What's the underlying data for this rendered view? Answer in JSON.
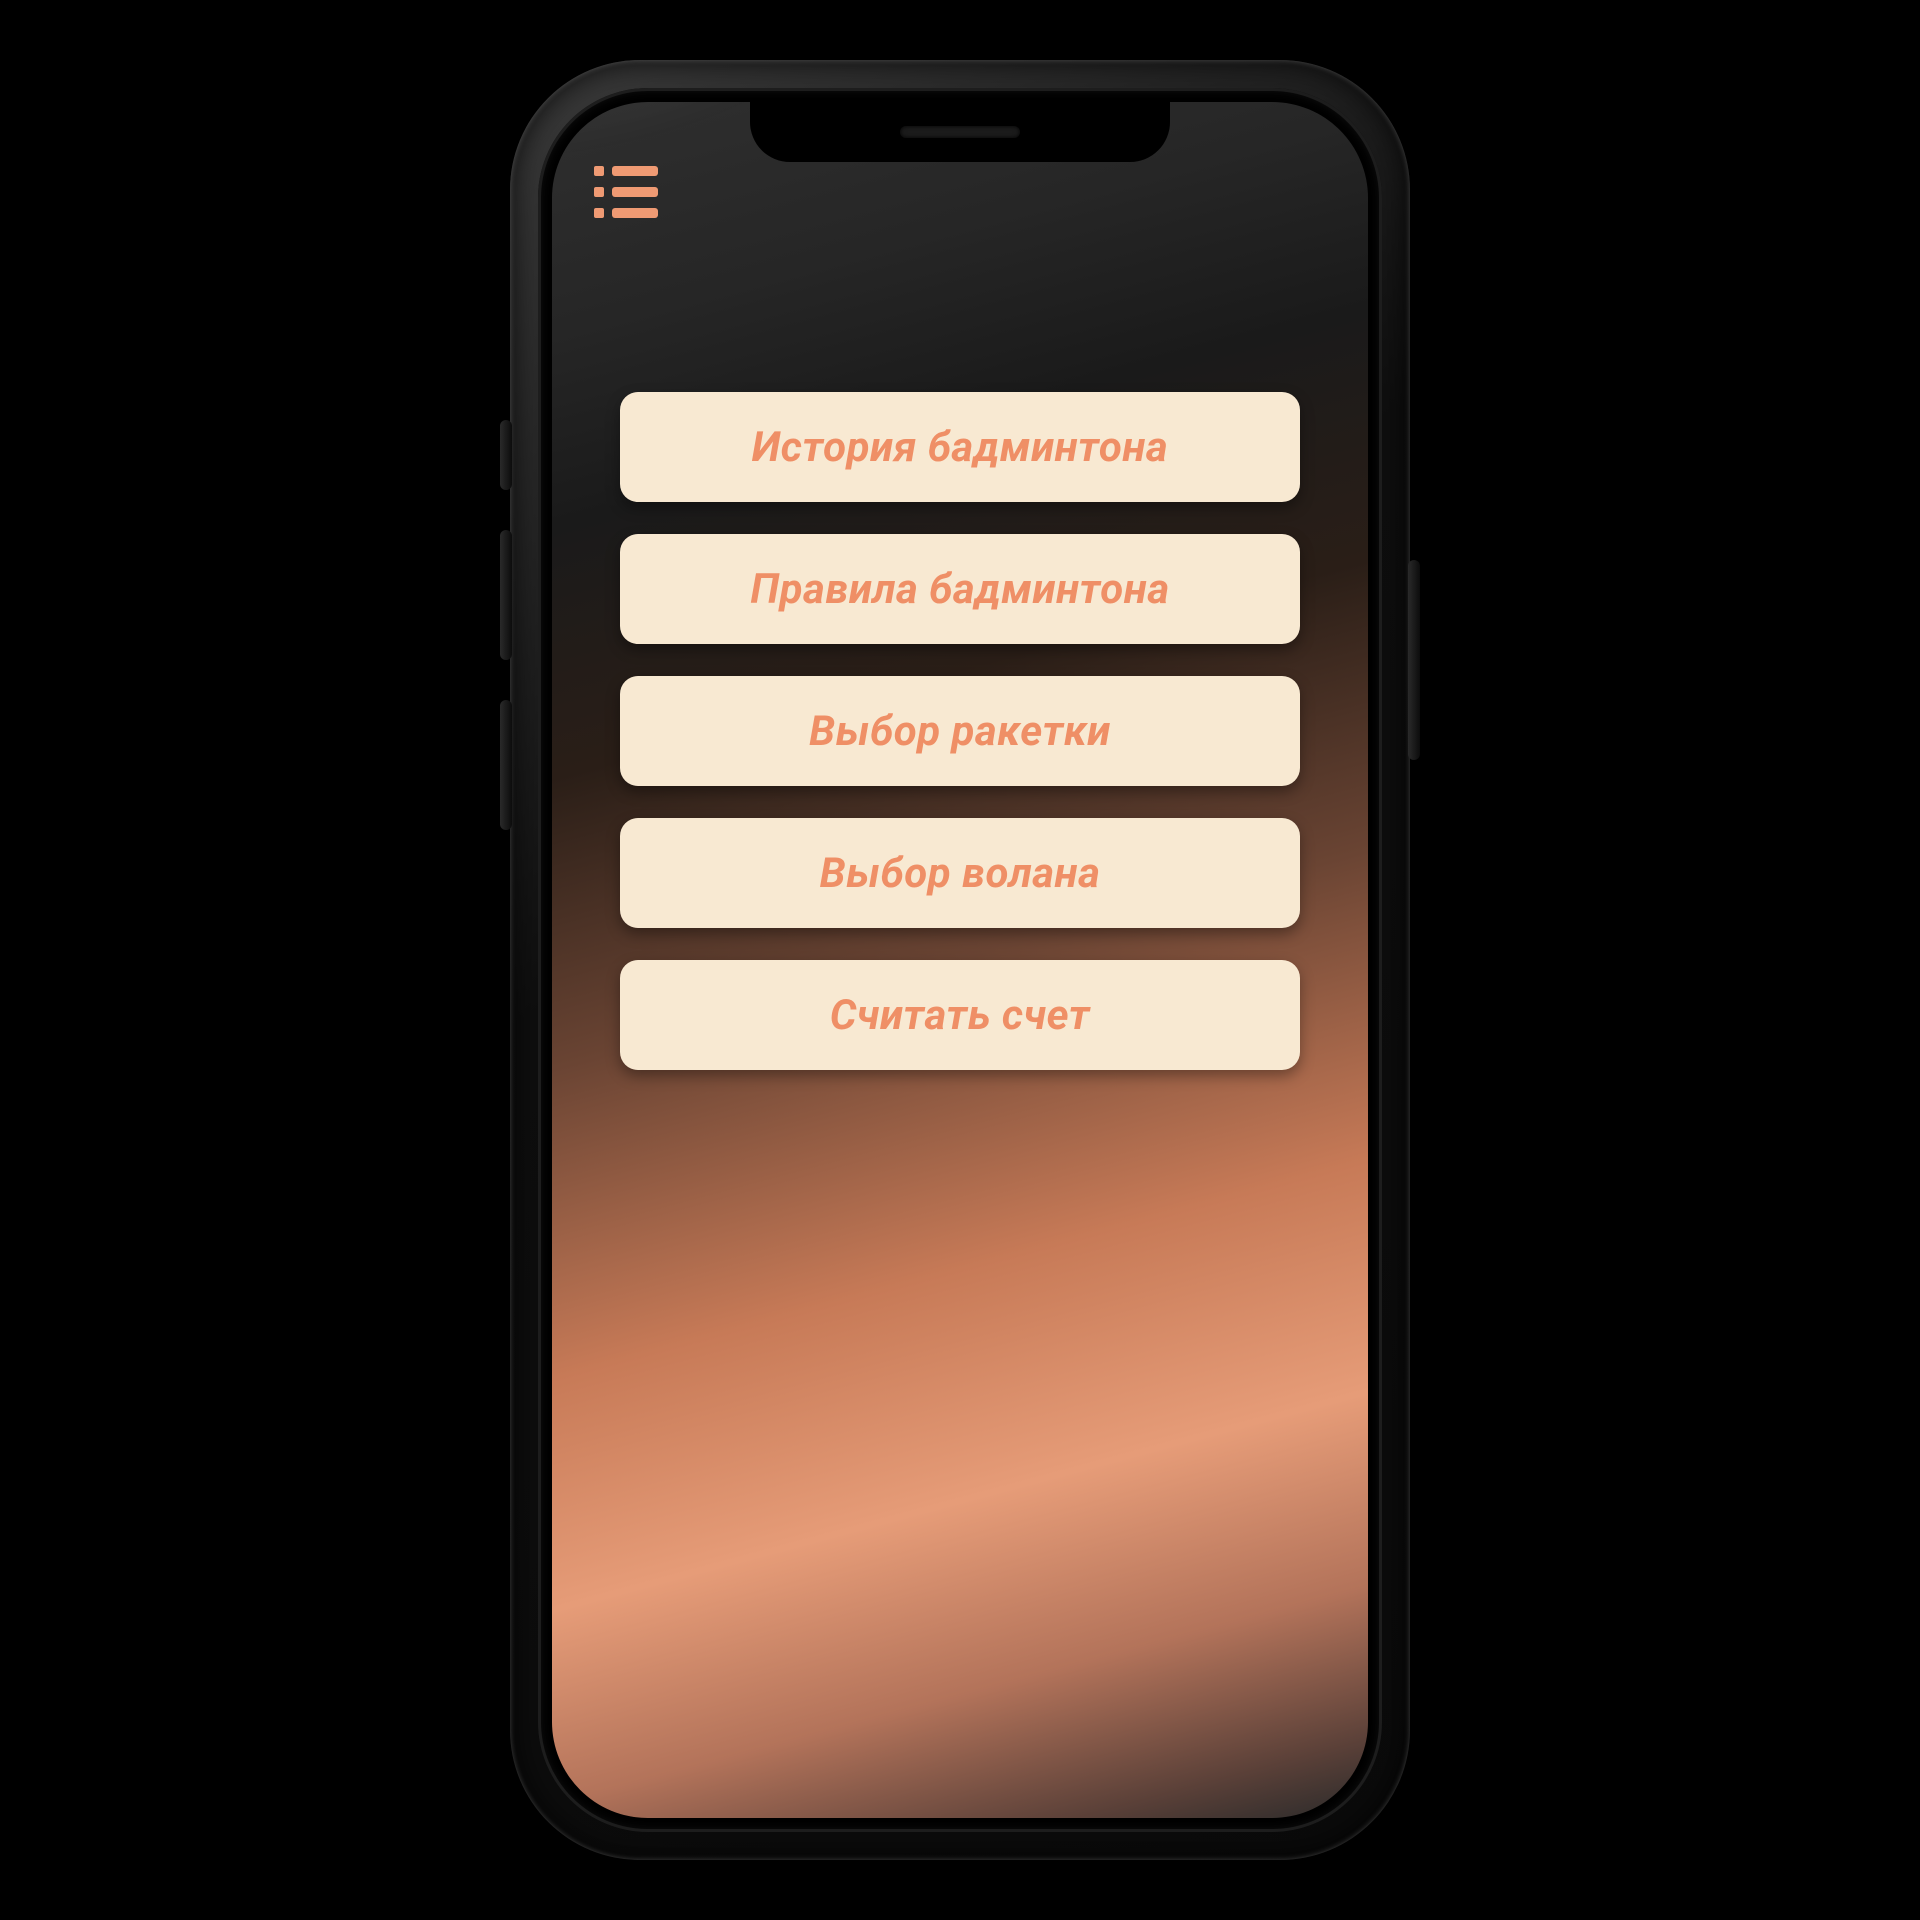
{
  "colors": {
    "accent": "#ef8f66",
    "button_bg": "#f8e9d2",
    "icon": "#ef9a73"
  },
  "header": {
    "menu_icon_name": "list-menu-icon"
  },
  "menu": {
    "items": [
      {
        "id": "history",
        "label": "История бадминтона"
      },
      {
        "id": "rules",
        "label": "Правила бадминтона"
      },
      {
        "id": "racket-choice",
        "label": "Выбор ракетки"
      },
      {
        "id": "shuttle-choice",
        "label": "Выбор волана"
      },
      {
        "id": "score-counter",
        "label": "Считать счет"
      }
    ]
  }
}
